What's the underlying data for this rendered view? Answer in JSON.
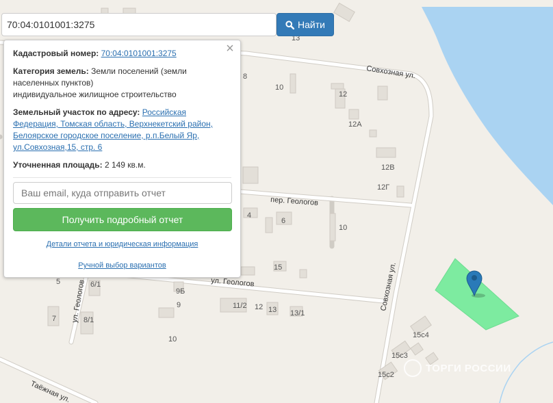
{
  "search": {
    "value": "70:04:0101001:3275",
    "button_label": "Найти"
  },
  "popup": {
    "cadastral_label": "Кадастровый номер:",
    "cadastral_value": "70:04:0101001:3275",
    "category_label": "Категория земель:",
    "category_value": "Земли поселений (земли населенных пунктов)",
    "category_use": "индивидуальное жилищное строительство",
    "address_label": "Земельный участок по адресу:",
    "address_value": "Российская Федерация, Томская область, Верхнекетский район, Белоярское городское поселение, р.п.Белый Яр, ул.Совхозная,15, стр. 6",
    "area_label": "Уточненная площадь:",
    "area_value": "2 149 кв.м.",
    "email_placeholder": "Ваш email, куда отправить отчет",
    "report_button": "Получить подробный отчет",
    "details_link": "Детали отчета и юридическая информация",
    "manual_link": "Ручной выбор вариантов"
  },
  "map": {
    "streets": {
      "sovkhoznaya_top": "Совхозная ул.",
      "sovkhoznaya_right": "Совхозная ул.",
      "geologov_lane": "пер. Геологов",
      "geologov_st": "ул. Геологов",
      "geologov_vertical": "ул. Геологов",
      "taezhnaya": "Таёжная ул."
    },
    "house_numbers": [
      "13",
      "8",
      "10",
      "12",
      "12А",
      "12В",
      "12Г",
      "4",
      "6",
      "10",
      "15",
      "5",
      "6/1",
      "9Б",
      "9",
      "11/2",
      "12",
      "13",
      "13/1",
      "7",
      "8/1",
      "10",
      "15с4",
      "15с3",
      "15с2"
    ],
    "parcel_color": "#7deba0",
    "water_color": "#aad3f2",
    "marker_color": "#2a7ab8"
  },
  "watermark": "ТОРГИ РОССИИ"
}
